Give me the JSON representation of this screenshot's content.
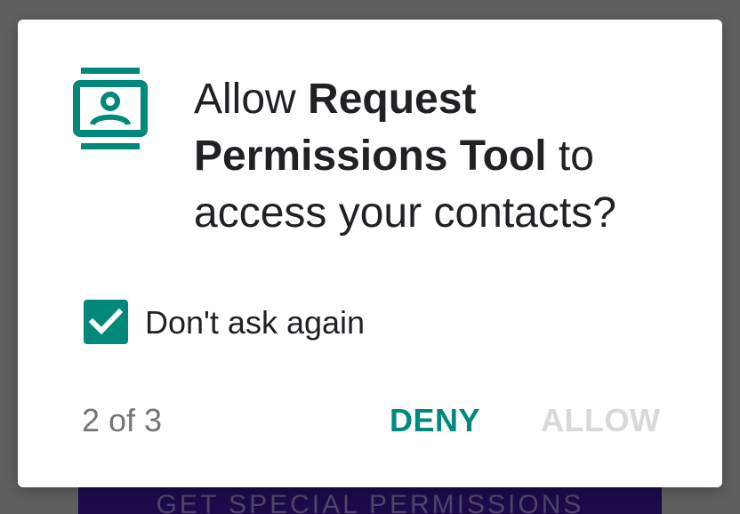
{
  "background": {
    "button_label": "GET SPECIAL PERMISSIONS"
  },
  "dialog": {
    "icon": "contacts-icon",
    "title_prefix": "Allow ",
    "app_name": "Request Permissions Tool",
    "title_suffix": " to access your contacts?",
    "checkbox": {
      "label": "Don't ask again",
      "checked": true
    },
    "counter": "2 of 3",
    "deny_label": "DENY",
    "allow_label": "ALLOW"
  },
  "colors": {
    "accent": "#00897b",
    "scrim": "#5f5f5f",
    "disabled_text": "#d9d9d9",
    "background_button": "#1d0a4a"
  }
}
